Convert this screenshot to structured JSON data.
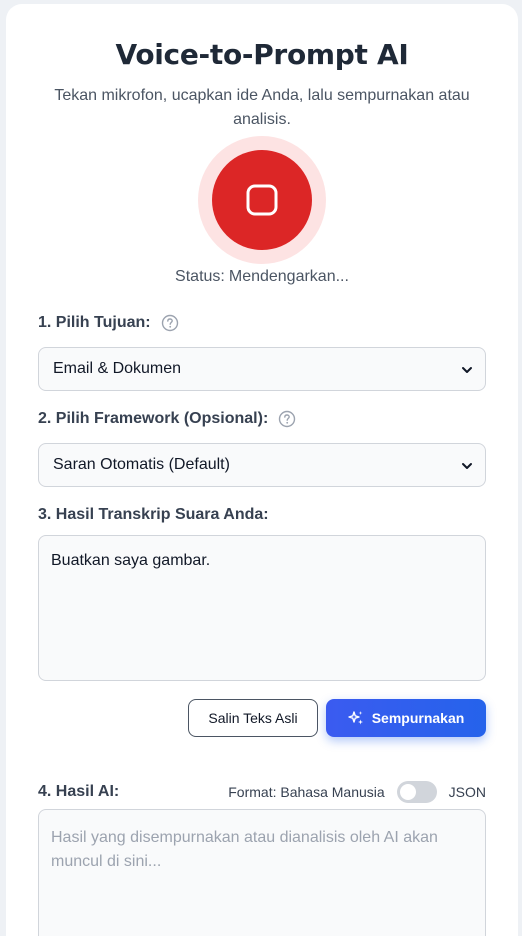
{
  "header": {
    "title": "Voice-to-Prompt AI",
    "subtitle": "Tekan mikrofon, ucapkan ide Anda, lalu sempurnakan atau analisis."
  },
  "recorder": {
    "state_icon": "stop-icon",
    "accent_color": "#dc2626",
    "status_label": "Status:",
    "status_value": "Mendengarkan..."
  },
  "purpose": {
    "label": "1. Pilih Tujuan:",
    "selected": "Email & Dokumen"
  },
  "framework": {
    "label": "2. Pilih Framework (Opsional):",
    "selected": "Saran Otomatis (Default)"
  },
  "transcript": {
    "label": "3. Hasil Transkrip Suara Anda:",
    "value": "Buatkan saya gambar."
  },
  "actions": {
    "copy_label": "Salin Teks Asli",
    "refine_label": "Sempurnakan",
    "primary_color": "#2563eb"
  },
  "result": {
    "label": "4. Hasil AI:",
    "format_label": "Format: Bahasa Manusia",
    "format_alt": "JSON",
    "json_enabled": false,
    "placeholder": "Hasil yang disempurnakan atau dianalisis oleh AI akan muncul di sini..."
  }
}
